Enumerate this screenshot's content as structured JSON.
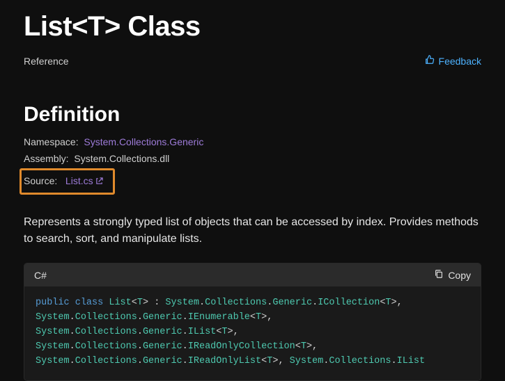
{
  "title": "List<T> Class",
  "reference_label": "Reference",
  "feedback_label": "Feedback",
  "definition_heading": "Definition",
  "namespace": {
    "label": "Namespace:",
    "value": "System.Collections.Generic"
  },
  "assembly": {
    "label": "Assembly:",
    "value": "System.Collections.dll"
  },
  "source": {
    "label": "Source:",
    "value": "List.cs"
  },
  "description": "Represents a strongly typed list of objects that can be accessed by index. Provides methods to search, sort, and manipulate lists.",
  "code": {
    "language": "C#",
    "copy_label": "Copy",
    "kw_public": "public",
    "kw_class": "class",
    "typename": "List",
    "typeparam": "T",
    "interfaces": [
      "System.Collections.Generic.ICollection<T>",
      "System.Collections.Generic.IEnumerable<T>",
      "System.Collections.Generic.IList<T>",
      "System.Collections.Generic.IReadOnlyCollection<T>",
      "System.Collections.Generic.IReadOnlyList<T>",
      "System.Collections.IList"
    ]
  }
}
